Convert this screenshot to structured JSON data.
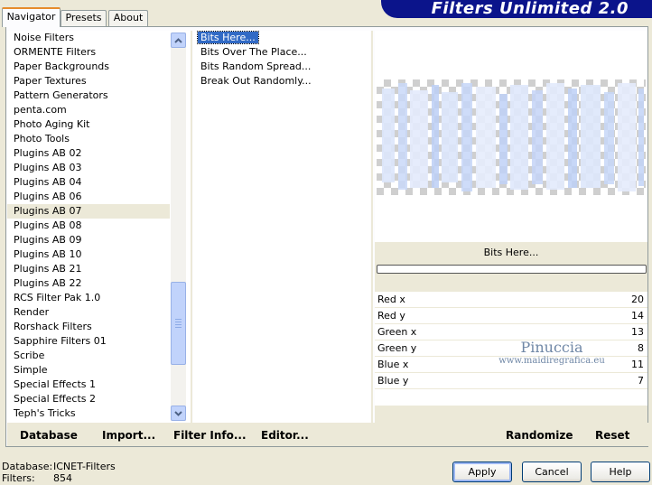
{
  "brand": {
    "title": "Filters Unlimited 2.0"
  },
  "tabs": [
    {
      "label": "Navigator",
      "active": true
    },
    {
      "label": "Presets",
      "active": false
    },
    {
      "label": "About",
      "active": false
    }
  ],
  "categories": {
    "items": [
      "Noise Filters",
      "ORMENTE Filters",
      "Paper Backgrounds",
      "Paper Textures",
      "Pattern Generators",
      "penta.com",
      "Photo Aging Kit",
      "Photo Tools",
      "Plugins AB 02",
      "Plugins AB 03",
      "Plugins AB 04",
      "Plugins AB 06",
      "Plugins AB 07",
      "Plugins AB 08",
      "Plugins AB 09",
      "Plugins AB 10",
      "Plugins AB 21",
      "Plugins AB 22",
      "RCS Filter Pak 1.0",
      "Render",
      "Rorshack Filters",
      "Sapphire Filters 01",
      "Scribe",
      "Simple",
      "Special Effects 1",
      "Special Effects 2",
      "Teph's Tricks"
    ],
    "selected": "Plugins AB 07"
  },
  "filters": {
    "items": [
      "Bits Here...",
      "Bits Over The Place...",
      "Bits Random Spread...",
      "Break Out Randomly..."
    ],
    "selected": "Bits Here..."
  },
  "current_filter": "Bits Here...",
  "params": [
    {
      "label": "Red x",
      "value": "20"
    },
    {
      "label": "Red y",
      "value": "14"
    },
    {
      "label": "Green x",
      "value": "13"
    },
    {
      "label": "Green y",
      "value": "8"
    },
    {
      "label": "Blue x",
      "value": "11"
    },
    {
      "label": "Blue y",
      "value": "7"
    }
  ],
  "watermark": {
    "line1": "Pinuccia",
    "line2": "www.maidiregrafica.eu"
  },
  "links": {
    "database": "Database",
    "import": "Import...",
    "filter_info": "Filter Info...",
    "editor": "Editor...",
    "randomize": "Randomize",
    "reset": "Reset"
  },
  "status": {
    "database_label": "Database:",
    "database_value": "ICNET-Filters",
    "filters_label": "Filters:",
    "filters_value": "854"
  },
  "buttons": {
    "apply": "Apply",
    "cancel": "Cancel",
    "help": "Help"
  },
  "colors": {
    "brand": "#0b148b",
    "selection": "#316ac5",
    "tab_highlight": "#e68b2c",
    "dialog_bg": "#ece9d8"
  },
  "icons": {
    "scroll_up": "chevron-up-icon",
    "scroll_down": "chevron-down-icon"
  }
}
